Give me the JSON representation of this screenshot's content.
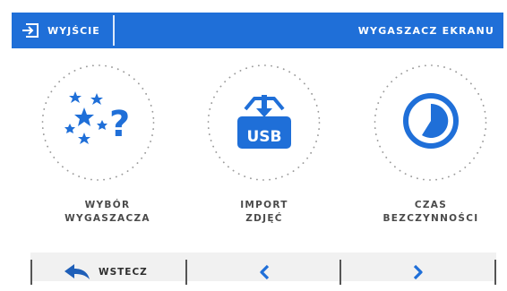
{
  "header": {
    "exit_label": "WYJŚCIE",
    "title": "WYGASZACZ EKRANU"
  },
  "tiles": [
    {
      "label_line1": "WYBÓR",
      "label_line2": "WYGASZACZA",
      "icon": "stars-question-icon"
    },
    {
      "label_line1": "IMPORT",
      "label_line2": "ZDJĘĆ",
      "icon": "usb-import-icon",
      "icon_text": "USB"
    },
    {
      "label_line1": "CZAS",
      "label_line2": "BEZCZYNNOŚCI",
      "icon": "clock-timer-icon"
    }
  ],
  "footer": {
    "back_label": "WSTECZ",
    "back_icon": "back-arrow-icon",
    "prev_icon": "chevron-left-icon",
    "next_icon": "chevron-right-icon"
  },
  "colors": {
    "accent": "#1f6fd8",
    "text": "#4a4a4a",
    "footer_bg": "#f1f1f1"
  }
}
